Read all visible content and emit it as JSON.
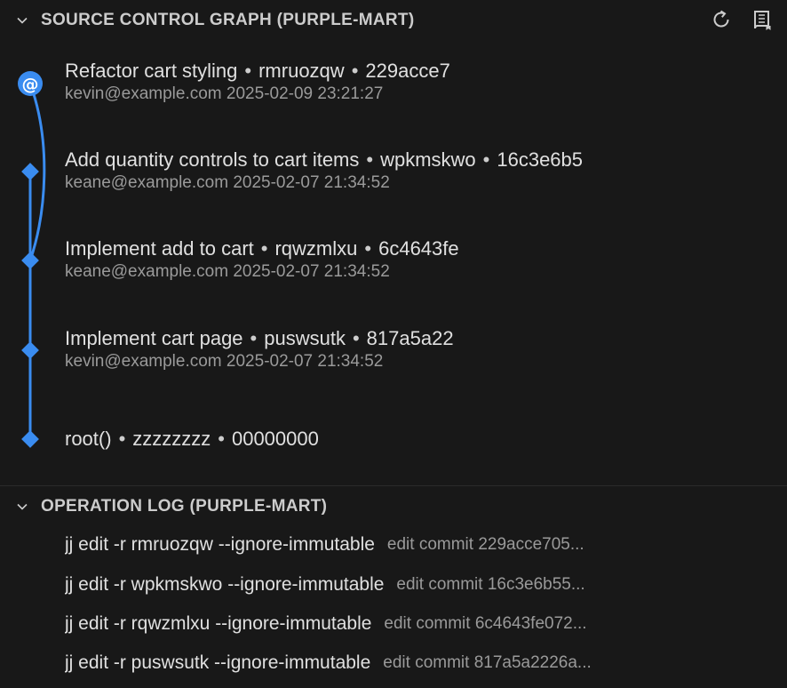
{
  "graph_section": {
    "title": "SOURCE CONTROL GRAPH (PURPLE-MART)",
    "actions": [
      {
        "icon": "refresh-icon"
      },
      {
        "icon": "repository-icon"
      }
    ],
    "commits": [
      {
        "description": "Refactor cart styling",
        "change_id": "rmruozqw",
        "commit_id": "229acce7",
        "author": "kevin@example.com",
        "timestamp": "2025-02-09 23:21:27",
        "is_working_copy": true,
        "marker": "@"
      },
      {
        "description": "Add quantity controls to cart items",
        "change_id": "wpkmskwo",
        "commit_id": "16c3e6b5",
        "author": "keane@example.com",
        "timestamp": "2025-02-07 21:34:52"
      },
      {
        "description": "Implement add to cart",
        "change_id": "rqwzmlxu",
        "commit_id": "6c4643fe",
        "author": "keane@example.com",
        "timestamp": "2025-02-07 21:34:52"
      },
      {
        "description": "Implement cart page",
        "change_id": "puswsutk",
        "commit_id": "817a5a22",
        "author": "kevin@example.com",
        "timestamp": "2025-02-07 21:34:52"
      },
      {
        "description": "root()",
        "change_id": "zzzzzzzz",
        "commit_id": "00000000"
      }
    ],
    "separator": "•",
    "graph_color": "#3a8cf0"
  },
  "oplog_section": {
    "title": "OPERATION LOG (PURPLE-MART)",
    "operations": [
      {
        "command": "jj edit -r rmruozqw --ignore-immutable",
        "description": "edit commit 229acce705..."
      },
      {
        "command": "jj edit -r wpkmskwo --ignore-immutable",
        "description": "edit commit 16c3e6b55..."
      },
      {
        "command": "jj edit -r rqwzmlxu --ignore-immutable",
        "description": "edit commit 6c4643fe072..."
      },
      {
        "command": "jj edit -r puswsutk --ignore-immutable",
        "description": "edit commit 817a5a2226a..."
      }
    ]
  }
}
